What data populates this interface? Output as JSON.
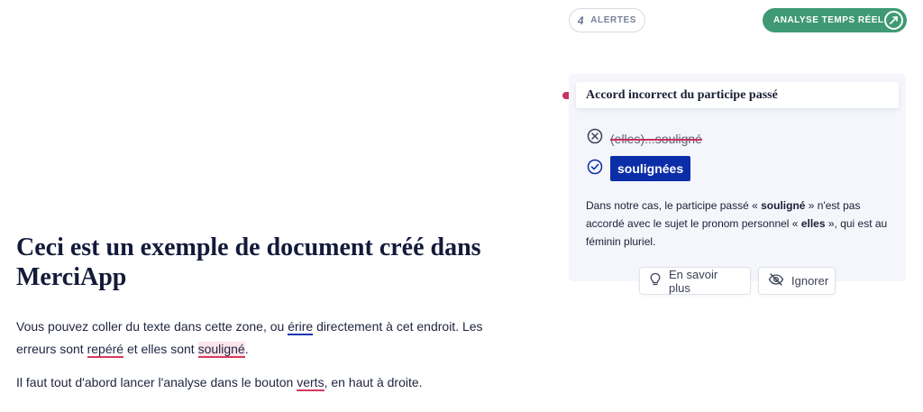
{
  "topbar": {
    "alerts_count": "4",
    "alerts_label": "ALERTES",
    "analysis_label": "ANALYSE TEMPS RÉEL"
  },
  "card": {
    "title": "Accord incorrect du participe passé",
    "wrong_text": "(elles)...souligné",
    "suggestion": "soulignées",
    "explanation": {
      "part1": "Dans notre cas, le participe passé « ",
      "bold1": "souligné",
      "part2": " » n'est pas accordé avec le sujet le pronom personnel « ",
      "bold2": "elles",
      "part3": " », qui est au féminin pluriel."
    },
    "learn_more_label": "En savoir plus",
    "ignore_label": "Ignorer"
  },
  "document": {
    "title": "Ceci est un exemple de document créé dans MerciApp",
    "p1": {
      "t1": "Vous pouvez coller du texte dans cette zone, ou ",
      "err1": "érire",
      "t2": " directement à cet endroit. Les erreurs sont ",
      "err2": "repéré",
      "t3": " et elles sont ",
      "err3": "souligné",
      "t4": "."
    },
    "p2": {
      "t1": "Il faut tout d'abord lancer l'analyse dans le bouton ",
      "err1": "verts",
      "t2": ", en haut à droite."
    }
  },
  "colors": {
    "accent_green": "#3f9a74",
    "suggestion_blue": "#0b2ea8",
    "error_red": "#c9325a"
  }
}
